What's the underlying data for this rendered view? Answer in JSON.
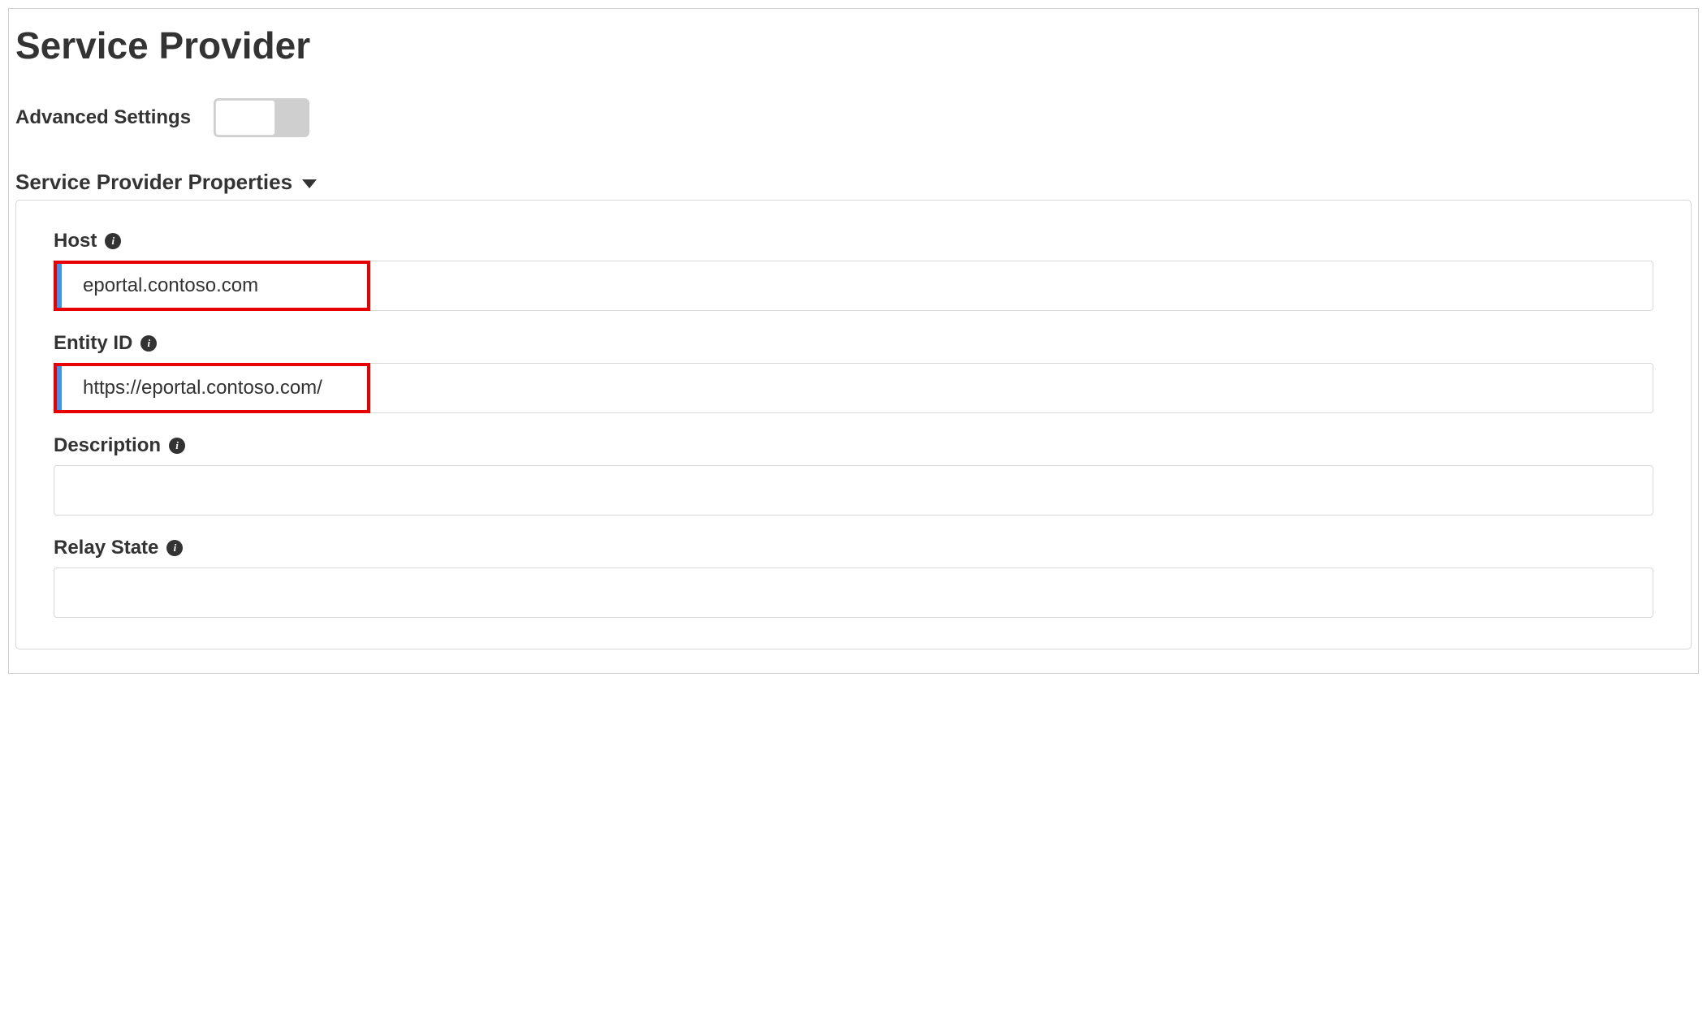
{
  "header": {
    "title": "Service Provider"
  },
  "advanced": {
    "label": "Advanced Settings",
    "enabled": false
  },
  "section": {
    "title": "Service Provider Properties"
  },
  "fields": {
    "host": {
      "label": "Host",
      "value": "eportal.contoso.com"
    },
    "entity_id": {
      "label": "Entity ID",
      "value": "https://eportal.contoso.com/"
    },
    "description": {
      "label": "Description",
      "value": ""
    },
    "relay_state": {
      "label": "Relay State",
      "value": ""
    }
  },
  "icons": {
    "info_glyph": "i"
  }
}
